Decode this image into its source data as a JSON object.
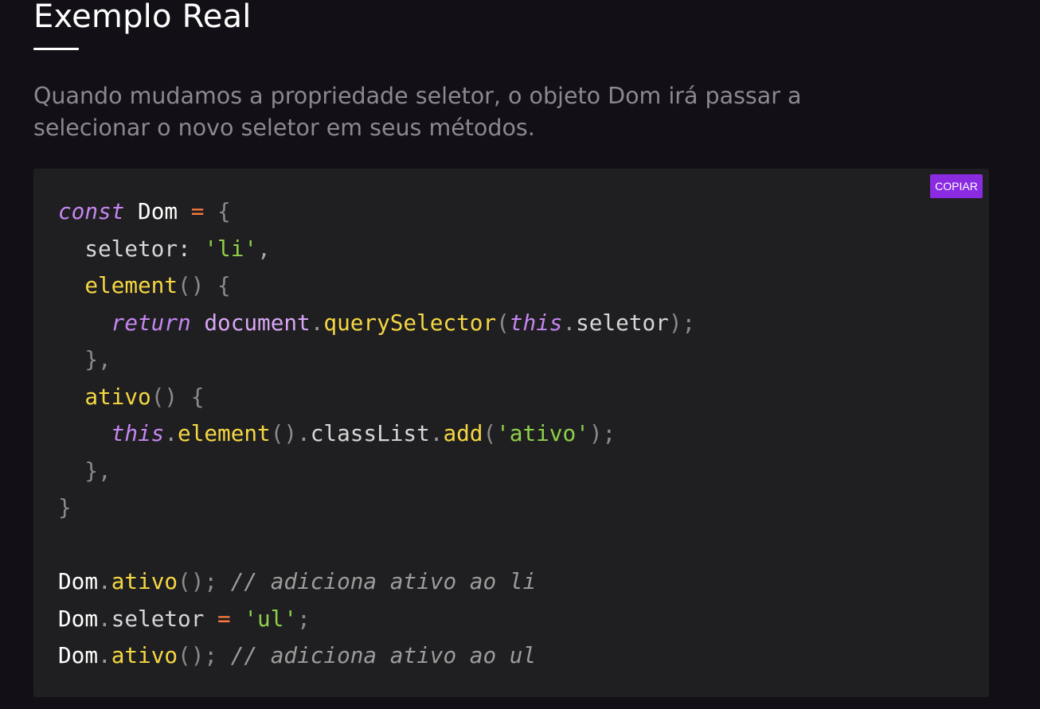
{
  "section": {
    "heading": "Exemplo Real",
    "intro_line1": "Quando mudamos a propriedade seletor, o objeto Dom irá passar a",
    "intro_line2": "selecionar o novo seletor em seus métodos."
  },
  "code_block": {
    "copy_label": "COPIAR",
    "accent_color": "#8a2be2",
    "lines": [
      [
        {
          "t": "kw",
          "v": "const"
        },
        {
          "t": "id",
          "v": " Dom "
        },
        {
          "t": "op",
          "v": "="
        },
        {
          "t": "br",
          "v": " {"
        }
      ],
      [
        {
          "t": "prop",
          "v": "  seletor: "
        },
        {
          "t": "str",
          "v": "'li'"
        },
        {
          "t": "punct",
          "v": ","
        }
      ],
      [
        {
          "t": "fn",
          "v": "  element"
        },
        {
          "t": "br",
          "v": "() {"
        }
      ],
      [
        {
          "t": "kw",
          "v": "    return"
        },
        {
          "t": "obj",
          "v": " document"
        },
        {
          "t": "dot",
          "v": "."
        },
        {
          "t": "fn",
          "v": "querySelector"
        },
        {
          "t": "br",
          "v": "("
        },
        {
          "t": "kw",
          "v": "this"
        },
        {
          "t": "dot",
          "v": "."
        },
        {
          "t": "prop",
          "v": "seletor"
        },
        {
          "t": "br",
          "v": ");"
        }
      ],
      [
        {
          "t": "br",
          "v": "  },"
        }
      ],
      [
        {
          "t": "fn",
          "v": "  ativo"
        },
        {
          "t": "br",
          "v": "() {"
        }
      ],
      [
        {
          "t": "kw",
          "v": "    this"
        },
        {
          "t": "dot",
          "v": "."
        },
        {
          "t": "fn",
          "v": "element"
        },
        {
          "t": "br",
          "v": "()"
        },
        {
          "t": "dot",
          "v": "."
        },
        {
          "t": "prop",
          "v": "classList"
        },
        {
          "t": "dot",
          "v": "."
        },
        {
          "t": "fn",
          "v": "add"
        },
        {
          "t": "br",
          "v": "("
        },
        {
          "t": "str",
          "v": "'ativo'"
        },
        {
          "t": "br",
          "v": ");"
        }
      ],
      [
        {
          "t": "br",
          "v": "  },"
        }
      ],
      [
        {
          "t": "br",
          "v": "}"
        }
      ],
      [],
      [
        {
          "t": "id",
          "v": "Dom"
        },
        {
          "t": "dot",
          "v": "."
        },
        {
          "t": "fn",
          "v": "ativo"
        },
        {
          "t": "br",
          "v": "();"
        },
        {
          "t": "comment",
          "v": " // adiciona ativo ao li"
        }
      ],
      [
        {
          "t": "id",
          "v": "Dom"
        },
        {
          "t": "dot",
          "v": "."
        },
        {
          "t": "prop",
          "v": "seletor "
        },
        {
          "t": "op",
          "v": "="
        },
        {
          "t": "str",
          "v": " 'ul'"
        },
        {
          "t": "br",
          "v": ";"
        }
      ],
      [
        {
          "t": "id",
          "v": "Dom"
        },
        {
          "t": "dot",
          "v": "."
        },
        {
          "t": "fn",
          "v": "ativo"
        },
        {
          "t": "br",
          "v": "();"
        },
        {
          "t": "comment",
          "v": " // adiciona ativo ao ul"
        }
      ]
    ]
  }
}
